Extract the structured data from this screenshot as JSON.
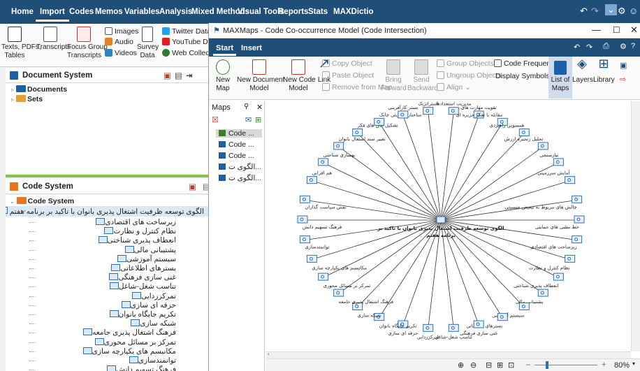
{
  "menubar": {
    "items": [
      "Home",
      "Import",
      "Codes",
      "Memos",
      "Variables",
      "Analysis",
      "Mixed Methods",
      "Visual Tools",
      "Reports",
      "Stats",
      "MAXDictio"
    ],
    "active": "Import"
  },
  "import_ribbon": {
    "texts_label": "Texts, PDFs,\nTables",
    "transcripts_label": "Transcripts",
    "focus_group_label": "Focus Group\nTranscripts",
    "images_label": "Images",
    "audio_label": "Audio",
    "videos_label": "Videos",
    "survey_label": "Survey\nData",
    "twitter_label": "Twitter Data",
    "youtube_label": "YouTube Data",
    "webcollector_label": "Web Collector D"
  },
  "document_system": {
    "title": "Document System",
    "items": [
      "Documents",
      "Sets"
    ]
  },
  "code_system": {
    "title": "Code System",
    "root": "Code System",
    "parent_code": "الگوی توسعه ظرفیت اشتغال پذیری بانوان با تاکید بر برنامه هفتم",
    "children": [
      "زیرساخت های اقتصادی",
      "نظام کنترل و نظارت",
      "انعطاف پذیری شناختی",
      "پشتیبانی مالی",
      "سیستم آموزشی",
      "بسترهای اطلاعاتی",
      "غنی سازی فرهنگی",
      "تناسب شغل-شاغل",
      "تمرکززدایی",
      "حرفه ای سازی",
      "تکریم جایگاه بانوان",
      "شبکه سازی",
      "فرهنگ اشتغال پذیری جامعه",
      "تمرکز بر مسائل محوری",
      "مکانیسم های یکپارچه سازی",
      "توانمندسازی",
      "فرهنگ تسهیم دانش"
    ]
  },
  "maxmaps": {
    "window_title": "MAXMaps - Code Co-occurrence Model (Code Intersection)",
    "tabs": [
      "Start",
      "Insert"
    ],
    "ribbon": {
      "new_map": "New\nMap",
      "new_document_model": "New Document\nModel",
      "new_code_model": "New Code\nModel",
      "link": "Link",
      "copy_object": "Copy Object",
      "paste_object": "Paste Object",
      "remove_from_map": "Remove from Map",
      "bring_forward": "Bring\nForward",
      "send_backward": "Send\nBackward",
      "group_objects": "Group Objects",
      "ungroup_objects": "Ungroup Objects",
      "align": "Align",
      "code_frequencies": "Code Frequencies",
      "display_symbols": "Display Symbols",
      "list_of_maps": "List of\nMaps",
      "layers": "Layers",
      "library": "Library"
    },
    "maps_panel": {
      "title": "Maps",
      "items": [
        "Code ...",
        "Code ...",
        "Code ...",
        "الگوی ت...",
        "الگوی ت..."
      ]
    },
    "center_label_1": "الگوی توسعه ظرفیت اشتغال پذیری بانوان با تاکید بر",
    "center_label_2": "برنامه هفتم",
    "zoom_label": "80%",
    "nodes": [
      "مدیریت استعدادها",
      "تقویت مهارت های",
      "مقابله با تفکر جزیره ای",
      "همسویی راهبردی",
      "تحلیل زنجیره ارزش",
      "نیازسنجی",
      "آمایش سرزمینی",
      "چالش های مربوط به تبعیض جنسیتی",
      "خط مشی های حمایتی",
      "زیرساخت های اقتصادی",
      "نظام کنترل و نظارت",
      "انعطاف پذیری شناختی",
      "پشتیبانی مالی",
      "سیستم آموزشی",
      "بسترهای اطلاعاتی",
      "غنی سازی فرهنگی",
      "تناسب شغل-شاغل",
      "تمرکززدایی",
      "حرفه ای سازی",
      "تکریم جایگاه بانوان",
      "شبکه سازی",
      "فرهنگ اشتغال پذیری جامعه",
      "تمرکز بر مسائل محوری",
      "مکانیسم های یکپارچه سازی",
      "توانمندسازی",
      "فرهنگ تسهیم دانش",
      "نقش سیاست گذاران",
      "هم افزایی",
      "بهسازی شناختی",
      "تغییر سند اشتغال بانوان",
      "تشکیل اتاق های فکر",
      "ساختار مدیریتی چابک",
      "بستر کارآفرینی",
      "استراتژیک"
    ]
  }
}
